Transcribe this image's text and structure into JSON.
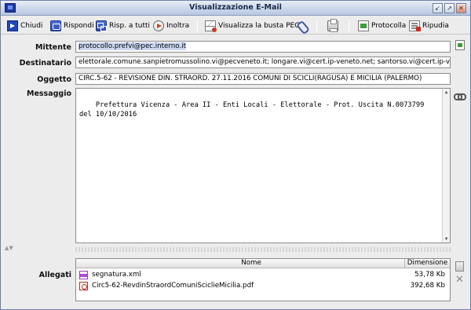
{
  "window": {
    "title": "Visualizzazione E-Mail"
  },
  "toolbar": {
    "chiudi": "Chiudi",
    "rispondi": "Rispondi",
    "risp_tutti": "Risp. a tutti",
    "inoltra": "Inoltra",
    "visualizza_busta": "Visualizza la busta PEC",
    "protocolla": "Protocolla",
    "ripudia": "Ripudia"
  },
  "fields": {
    "mittente_label": "Mittente",
    "mittente_value": "protocollo.prefvi@pec.interno.it",
    "destinatario_label": "Destinatario",
    "destinatario_value": "elettorale.comune.sanpietromussolino.vi@pecveneto.it; longare.vi@cert.ip-veneto.net; santorso.vi@cert.ip-veneto.net",
    "oggetto_label": "Oggetto",
    "oggetto_value": "CIRC.5-62 - REVISIONE DIN. STRAORD. 27.11.2016 COMUNI DI SCICLI(RAGUSA) E MICILIA (PALERMO)",
    "messaggio_label": "Messaggio",
    "messaggio_value": "Prefettura Vicenza - Area II - Enti Locali - Elettorale - Prot. Uscita N.0073799\ndel 10/10/2016"
  },
  "attachments": {
    "label": "Allegati",
    "col_nome": "Nome",
    "col_dimensione": "Dimensione",
    "rows": [
      {
        "name": "segnatura.xml",
        "size": "53,78 Kb"
      },
      {
        "name": "Circ5-62-RevdinStraordComuniScicliеMicilia.pdf",
        "size": "392,68 Kb"
      }
    ]
  }
}
